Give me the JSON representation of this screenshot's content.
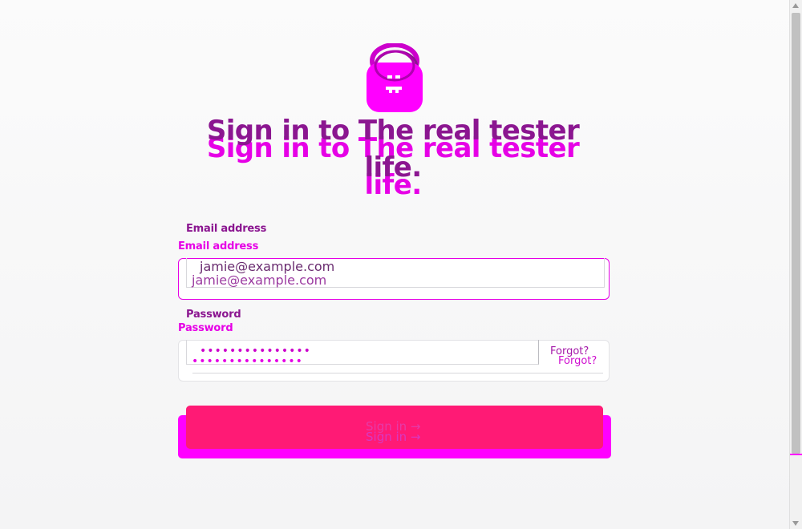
{
  "title": "Sign in to The real tester life.",
  "form": {
    "email_label": "Email address",
    "email_value": "jamie@example.com",
    "password_label": "Password",
    "password_value": "•••••••••••••••",
    "forgot_link": "Forgot?",
    "submit_label": "Sign in →"
  },
  "colors": {
    "accent_magenta": "#ff00ff",
    "brand_purple": "#8b1690",
    "button_pink": "#ff1a75"
  },
  "icons": {
    "logo": "bag-logo-icon"
  }
}
